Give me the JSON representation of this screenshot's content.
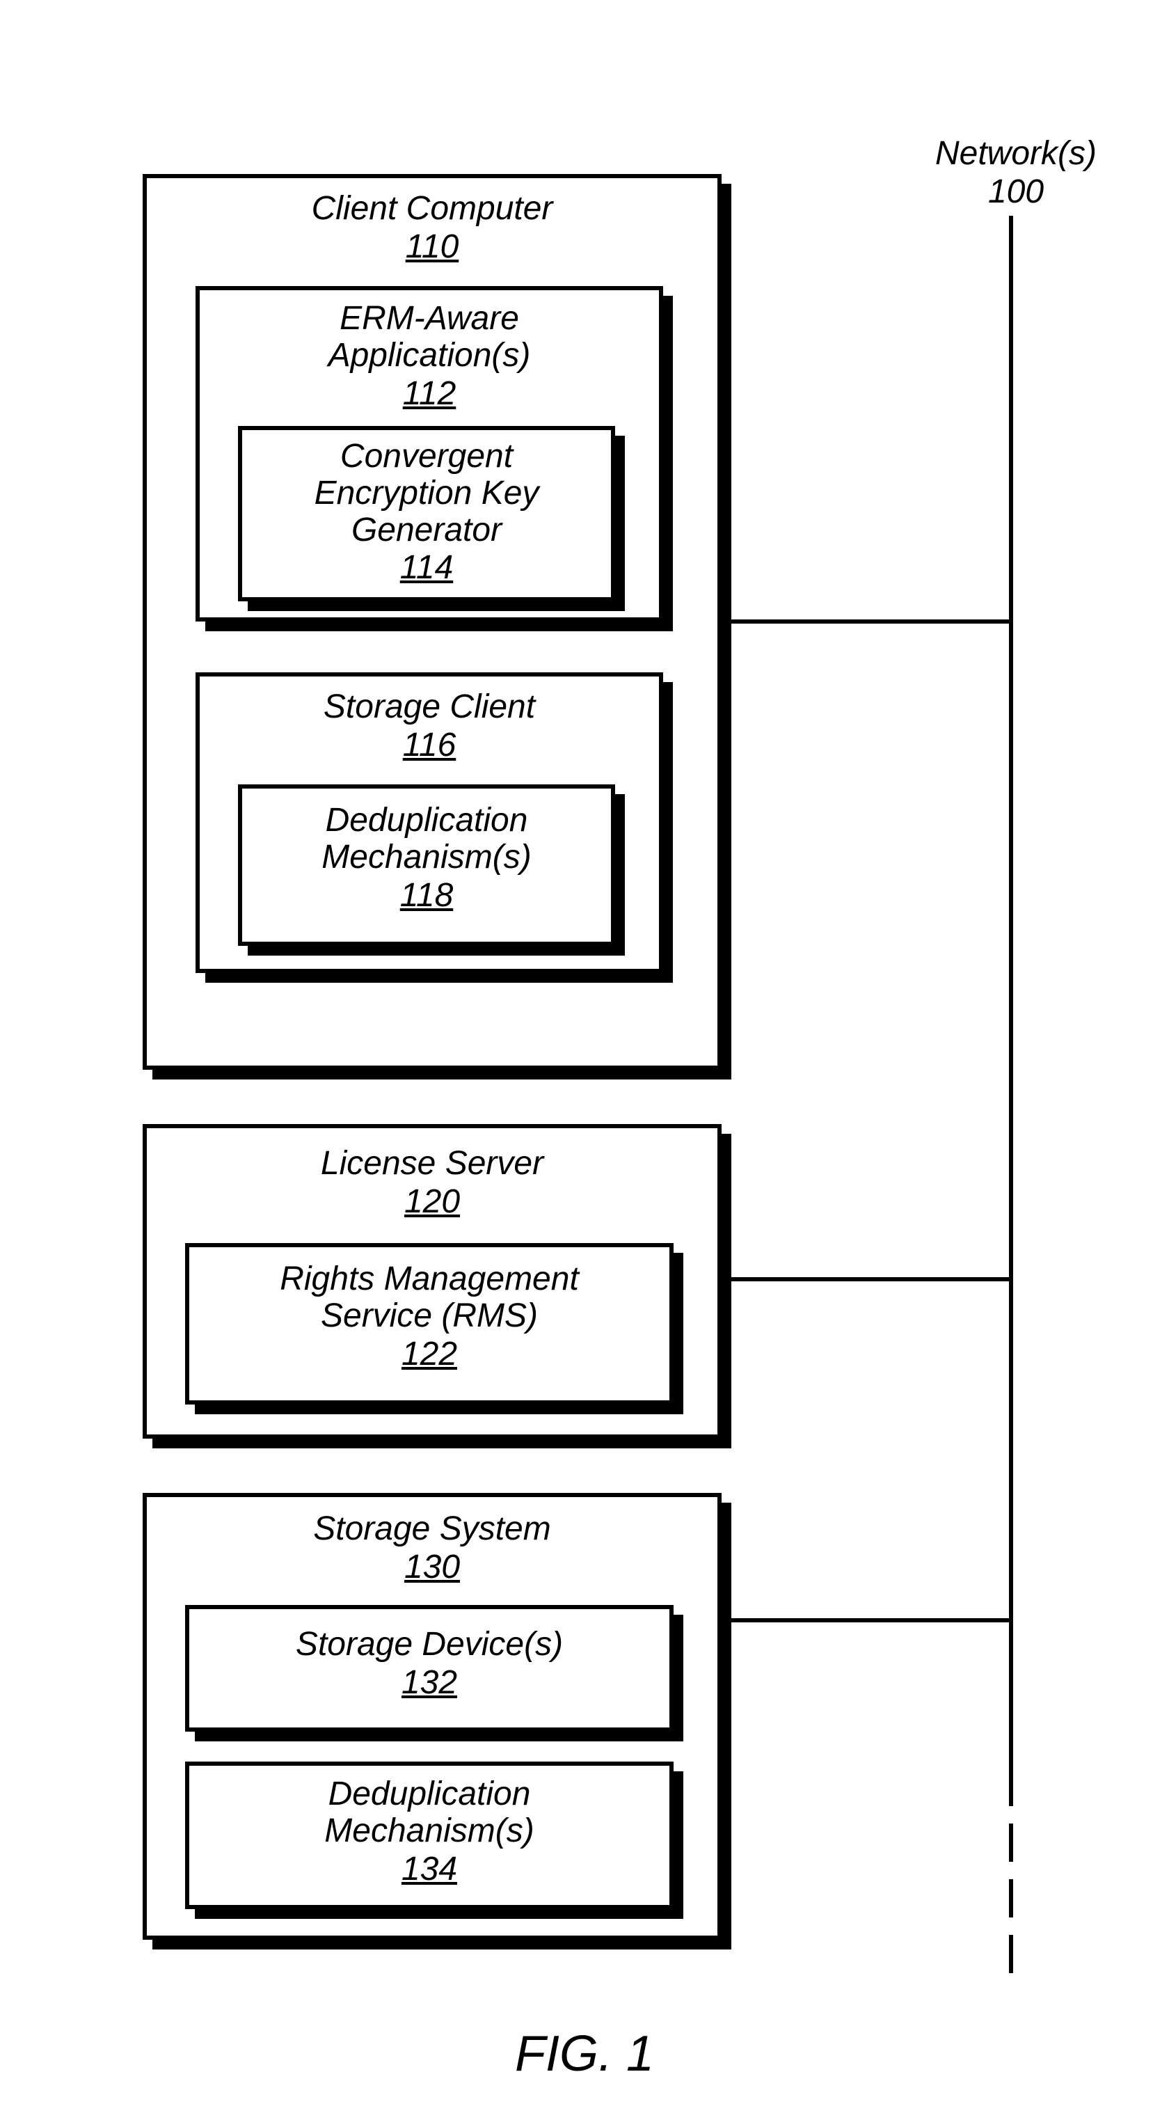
{
  "network": {
    "title": "Network(s)",
    "num": "100"
  },
  "client": {
    "title": "Client Computer",
    "num": "110",
    "erm": {
      "title": "ERM-Aware",
      "title2": "Application(s)",
      "num": "112",
      "keygen": {
        "l1": "Convergent",
        "l2": "Encryption Key",
        "l3": "Generator",
        "num": "114"
      }
    },
    "storage_client": {
      "title": "Storage Client",
      "num": "116",
      "dedup": {
        "l1": "Deduplication",
        "l2": "Mechanism(s)",
        "num": "118"
      }
    }
  },
  "license": {
    "title": "License Server",
    "num": "120",
    "rms": {
      "l1": "Rights Management",
      "l2": "Service (RMS)",
      "num": "122"
    }
  },
  "storage_system": {
    "title": "Storage System",
    "num": "130",
    "devices": {
      "l1": "Storage Device(s)",
      "num": "132"
    },
    "dedup": {
      "l1": "Deduplication",
      "l2": "Mechanism(s)",
      "num": "134"
    }
  },
  "figure": "FIG. 1"
}
